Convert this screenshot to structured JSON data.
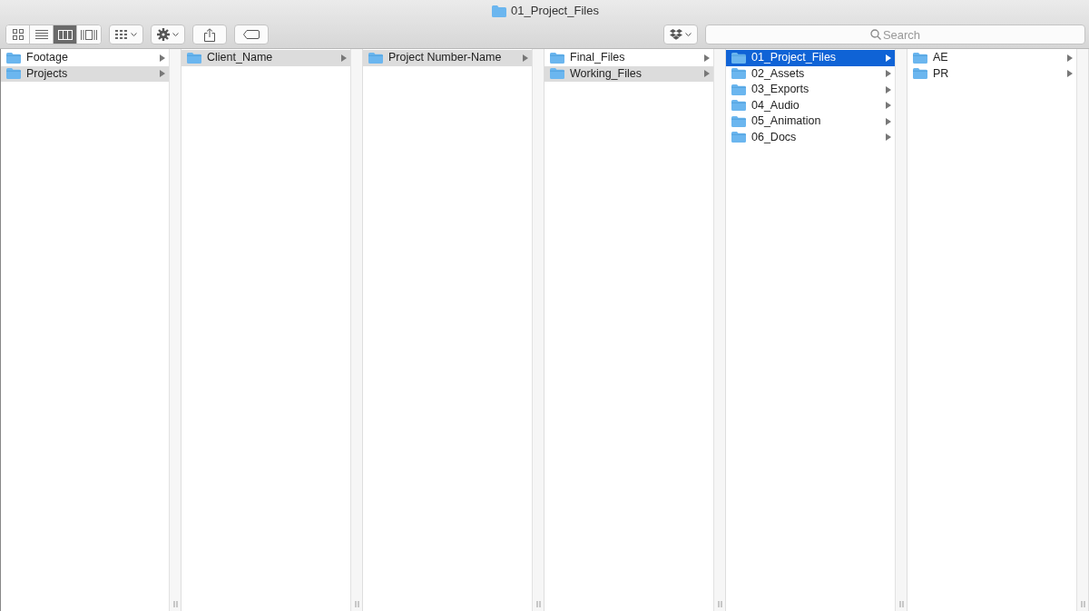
{
  "window": {
    "title": "01_Project_Files"
  },
  "toolbar": {
    "view_buttons": [
      {
        "kind": "icons",
        "selected": false
      },
      {
        "kind": "list",
        "selected": false
      },
      {
        "kind": "columns",
        "selected": true
      },
      {
        "kind": "coverflow",
        "selected": false
      }
    ],
    "search": {
      "placeholder": "Search"
    }
  },
  "columns": [
    {
      "items": [
        {
          "name": "Footage",
          "selected": false,
          "focused": false
        },
        {
          "name": "Projects",
          "selected": true,
          "focused": false
        }
      ]
    },
    {
      "items": [
        {
          "name": "Client_Name",
          "selected": true,
          "focused": false
        }
      ]
    },
    {
      "items": [
        {
          "name": "Project Number-Name",
          "selected": true,
          "focused": false
        }
      ]
    },
    {
      "items": [
        {
          "name": "Final_Files",
          "selected": false,
          "focused": false
        },
        {
          "name": "Working_Files",
          "selected": true,
          "focused": false
        }
      ]
    },
    {
      "items": [
        {
          "name": "01_Project_Files",
          "selected": true,
          "focused": true
        },
        {
          "name": "02_Assets",
          "selected": false,
          "focused": false
        },
        {
          "name": "03_Exports",
          "selected": false,
          "focused": false
        },
        {
          "name": "04_Audio",
          "selected": false,
          "focused": false
        },
        {
          "name": "05_Animation",
          "selected": false,
          "focused": false
        },
        {
          "name": "06_Docs",
          "selected": false,
          "focused": false
        }
      ]
    },
    {
      "items": [
        {
          "name": "AE",
          "selected": false,
          "focused": false
        },
        {
          "name": "PR",
          "selected": false,
          "focused": false
        }
      ]
    }
  ]
}
